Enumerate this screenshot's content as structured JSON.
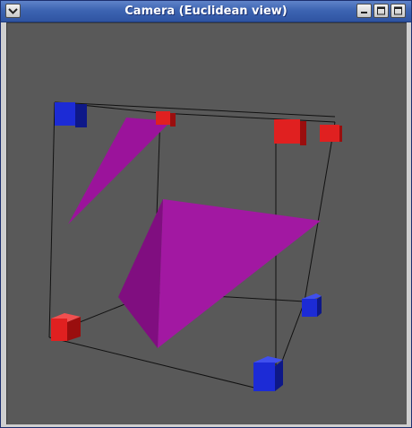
{
  "window": {
    "title": "Camera (Euclidean view)",
    "icons": {
      "menu": "chevron-down-icon",
      "minimize": "minimize-icon",
      "maximize": "maximize-icon",
      "close": "close-icon"
    }
  },
  "scene": {
    "background_color": "#595959",
    "edge_color": "#111111",
    "plane_color": "#9b139b",
    "marker_colors": {
      "red": "#e02020",
      "blue": "#1c2bd6"
    }
  }
}
